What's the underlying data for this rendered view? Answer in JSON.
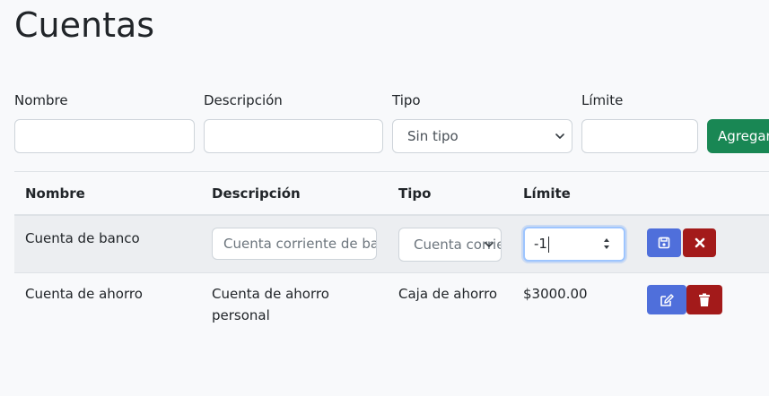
{
  "page": {
    "title": "Cuentas"
  },
  "form": {
    "nombre_label": "Nombre",
    "descripcion_label": "Descripción",
    "tipo_label": "Tipo",
    "limite_label": "Límite",
    "nombre_value": "",
    "descripcion_value": "",
    "tipo_selected": "Sin tipo",
    "limite_value": "",
    "add_button": "Agregar"
  },
  "table": {
    "headers": [
      "Nombre",
      "Descripción",
      "Tipo",
      "Límite"
    ],
    "rows": [
      {
        "nombre": "Cuenta de banco",
        "descripcion_edit": "Cuenta corriente de banco",
        "tipo_edit": "Cuenta corriente",
        "limite_edit": "-1",
        "editing": true
      },
      {
        "nombre": "Cuenta de ahorro",
        "descripcion_line1": "Cuenta de ahorro",
        "descripcion_line2": "personal",
        "tipo": "Caja de ahorro",
        "limite": "$3000.00",
        "editing": false
      }
    ]
  },
  "icons": {
    "save": "save-icon",
    "cancel": "close-icon",
    "edit": "edit-icon",
    "delete": "trash-icon",
    "select": "chevron-down-icon"
  },
  "colors": {
    "primary": "#4f6fdb",
    "danger": "#a31a1a",
    "success": "#198754"
  }
}
